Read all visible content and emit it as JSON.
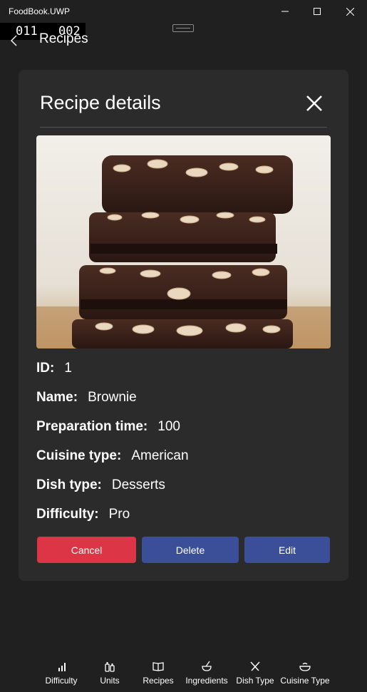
{
  "window": {
    "title": "FoodBook.UWP",
    "minimize_icon": "minimize-icon",
    "maximize_icon": "maximize-icon",
    "close_icon": "close-icon"
  },
  "debug_counter": {
    "a": "011",
    "b": "002"
  },
  "header": {
    "back_icon": "back-arrow-icon",
    "title": "Recipes"
  },
  "dialog": {
    "title": "Recipe details",
    "close_icon": "close-icon",
    "image_alt": "Brownie",
    "fields": [
      {
        "label": "ID:",
        "value": "1"
      },
      {
        "label": "Name:",
        "value": "Brownie"
      },
      {
        "label": "Preparation time:",
        "value": "100"
      },
      {
        "label": "Cuisine type:",
        "value": "American"
      },
      {
        "label": "Dish type:",
        "value": "Desserts"
      },
      {
        "label": "Difficulty:",
        "value": "Pro"
      }
    ],
    "buttons": {
      "cancel": "Cancel",
      "delete": "Delete",
      "edit": "Edit"
    },
    "colors": {
      "cancel": "#dc3545",
      "primary": "#3a4f97",
      "surface": "#2b2b2b",
      "background": "#202020"
    }
  },
  "bottom_nav": [
    {
      "label": "Difficulty",
      "icon": "bar-chart-icon"
    },
    {
      "label": "Units",
      "icon": "bottles-icon"
    },
    {
      "label": "Recipes",
      "icon": "book-icon"
    },
    {
      "label": "Ingredients",
      "icon": "bowl-spoon-icon"
    },
    {
      "label": "Dish Type",
      "icon": "fork-knife-icon"
    },
    {
      "label": "Cuisine Type",
      "icon": "bowl-icon"
    }
  ]
}
